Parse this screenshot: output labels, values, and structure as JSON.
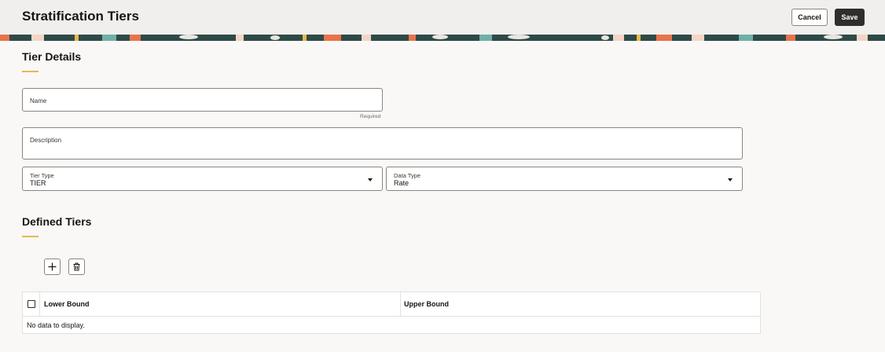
{
  "header": {
    "title": "Stratification Tiers",
    "cancel_label": "Cancel",
    "save_label": "Save"
  },
  "tier_details": {
    "section_title": "Tier Details",
    "name_label": "Name",
    "name_value": "",
    "name_helper": "Required",
    "description_label": "Description",
    "description_value": "",
    "tier_type_label": "Tier Type",
    "tier_type_value": "TIER",
    "data_type_label": "Data Type",
    "data_type_value": "Rate"
  },
  "defined_tiers": {
    "section_title": "Defined Tiers",
    "add_icon": "plus-icon",
    "delete_icon": "trash-icon",
    "columns": [
      "Lower Bound",
      "Upper Bound"
    ],
    "rows": [],
    "empty_message": "No data to display."
  },
  "colors": {
    "accent_underline": "#e8b94a",
    "primary_button": "#312d2a",
    "header_bg": "#f1efed",
    "page_bg": "#f9f8f6"
  }
}
